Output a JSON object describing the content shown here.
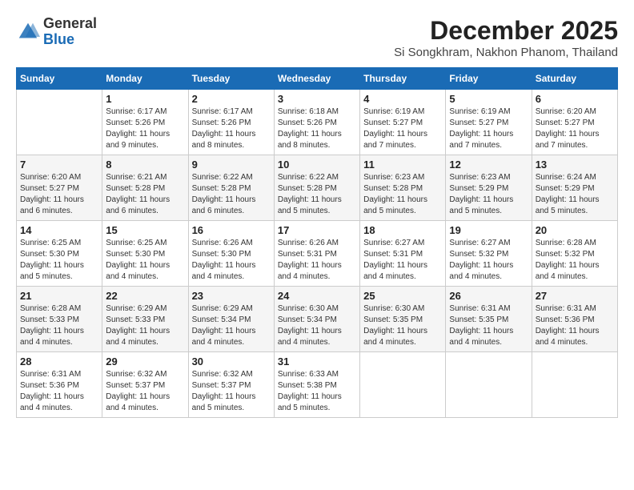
{
  "header": {
    "logo_general": "General",
    "logo_blue": "Blue",
    "month": "December 2025",
    "location": "Si Songkhram, Nakhon Phanom, Thailand"
  },
  "days_of_week": [
    "Sunday",
    "Monday",
    "Tuesday",
    "Wednesday",
    "Thursday",
    "Friday",
    "Saturday"
  ],
  "weeks": [
    [
      {
        "day": "",
        "info": ""
      },
      {
        "day": "1",
        "info": "Sunrise: 6:17 AM\nSunset: 5:26 PM\nDaylight: 11 hours\nand 9 minutes."
      },
      {
        "day": "2",
        "info": "Sunrise: 6:17 AM\nSunset: 5:26 PM\nDaylight: 11 hours\nand 8 minutes."
      },
      {
        "day": "3",
        "info": "Sunrise: 6:18 AM\nSunset: 5:26 PM\nDaylight: 11 hours\nand 8 minutes."
      },
      {
        "day": "4",
        "info": "Sunrise: 6:19 AM\nSunset: 5:27 PM\nDaylight: 11 hours\nand 7 minutes."
      },
      {
        "day": "5",
        "info": "Sunrise: 6:19 AM\nSunset: 5:27 PM\nDaylight: 11 hours\nand 7 minutes."
      },
      {
        "day": "6",
        "info": "Sunrise: 6:20 AM\nSunset: 5:27 PM\nDaylight: 11 hours\nand 7 minutes."
      }
    ],
    [
      {
        "day": "7",
        "info": "Sunrise: 6:20 AM\nSunset: 5:27 PM\nDaylight: 11 hours\nand 6 minutes."
      },
      {
        "day": "8",
        "info": "Sunrise: 6:21 AM\nSunset: 5:28 PM\nDaylight: 11 hours\nand 6 minutes."
      },
      {
        "day": "9",
        "info": "Sunrise: 6:22 AM\nSunset: 5:28 PM\nDaylight: 11 hours\nand 6 minutes."
      },
      {
        "day": "10",
        "info": "Sunrise: 6:22 AM\nSunset: 5:28 PM\nDaylight: 11 hours\nand 5 minutes."
      },
      {
        "day": "11",
        "info": "Sunrise: 6:23 AM\nSunset: 5:28 PM\nDaylight: 11 hours\nand 5 minutes."
      },
      {
        "day": "12",
        "info": "Sunrise: 6:23 AM\nSunset: 5:29 PM\nDaylight: 11 hours\nand 5 minutes."
      },
      {
        "day": "13",
        "info": "Sunrise: 6:24 AM\nSunset: 5:29 PM\nDaylight: 11 hours\nand 5 minutes."
      }
    ],
    [
      {
        "day": "14",
        "info": "Sunrise: 6:25 AM\nSunset: 5:30 PM\nDaylight: 11 hours\nand 5 minutes."
      },
      {
        "day": "15",
        "info": "Sunrise: 6:25 AM\nSunset: 5:30 PM\nDaylight: 11 hours\nand 4 minutes."
      },
      {
        "day": "16",
        "info": "Sunrise: 6:26 AM\nSunset: 5:30 PM\nDaylight: 11 hours\nand 4 minutes."
      },
      {
        "day": "17",
        "info": "Sunrise: 6:26 AM\nSunset: 5:31 PM\nDaylight: 11 hours\nand 4 minutes."
      },
      {
        "day": "18",
        "info": "Sunrise: 6:27 AM\nSunset: 5:31 PM\nDaylight: 11 hours\nand 4 minutes."
      },
      {
        "day": "19",
        "info": "Sunrise: 6:27 AM\nSunset: 5:32 PM\nDaylight: 11 hours\nand 4 minutes."
      },
      {
        "day": "20",
        "info": "Sunrise: 6:28 AM\nSunset: 5:32 PM\nDaylight: 11 hours\nand 4 minutes."
      }
    ],
    [
      {
        "day": "21",
        "info": "Sunrise: 6:28 AM\nSunset: 5:33 PM\nDaylight: 11 hours\nand 4 minutes."
      },
      {
        "day": "22",
        "info": "Sunrise: 6:29 AM\nSunset: 5:33 PM\nDaylight: 11 hours\nand 4 minutes."
      },
      {
        "day": "23",
        "info": "Sunrise: 6:29 AM\nSunset: 5:34 PM\nDaylight: 11 hours\nand 4 minutes."
      },
      {
        "day": "24",
        "info": "Sunrise: 6:30 AM\nSunset: 5:34 PM\nDaylight: 11 hours\nand 4 minutes."
      },
      {
        "day": "25",
        "info": "Sunrise: 6:30 AM\nSunset: 5:35 PM\nDaylight: 11 hours\nand 4 minutes."
      },
      {
        "day": "26",
        "info": "Sunrise: 6:31 AM\nSunset: 5:35 PM\nDaylight: 11 hours\nand 4 minutes."
      },
      {
        "day": "27",
        "info": "Sunrise: 6:31 AM\nSunset: 5:36 PM\nDaylight: 11 hours\nand 4 minutes."
      }
    ],
    [
      {
        "day": "28",
        "info": "Sunrise: 6:31 AM\nSunset: 5:36 PM\nDaylight: 11 hours\nand 4 minutes."
      },
      {
        "day": "29",
        "info": "Sunrise: 6:32 AM\nSunset: 5:37 PM\nDaylight: 11 hours\nand 4 minutes."
      },
      {
        "day": "30",
        "info": "Sunrise: 6:32 AM\nSunset: 5:37 PM\nDaylight: 11 hours\nand 5 minutes."
      },
      {
        "day": "31",
        "info": "Sunrise: 6:33 AM\nSunset: 5:38 PM\nDaylight: 11 hours\nand 5 minutes."
      },
      {
        "day": "",
        "info": ""
      },
      {
        "day": "",
        "info": ""
      },
      {
        "day": "",
        "info": ""
      }
    ]
  ]
}
